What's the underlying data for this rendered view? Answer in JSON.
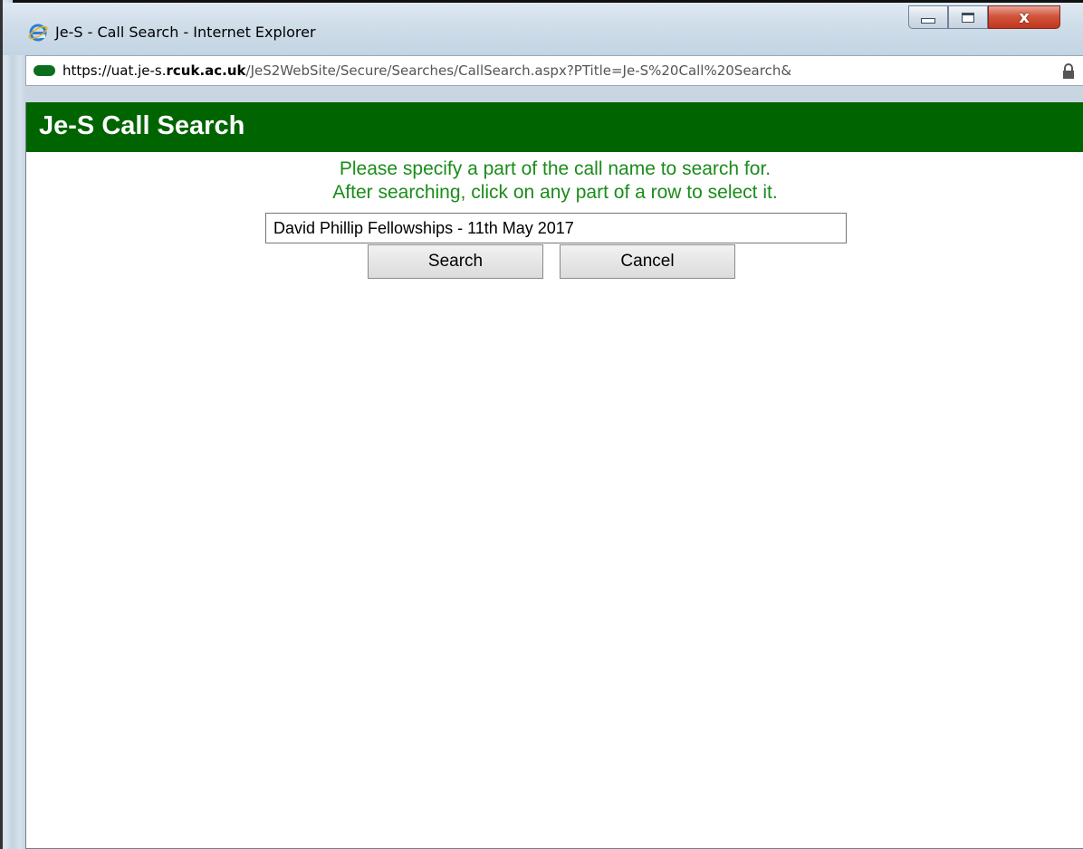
{
  "window": {
    "title": "Je-S - Call Search - Internet Explorer",
    "controls": {
      "minimize": "minimize-icon",
      "maximize": "maximize-icon",
      "close": "close-icon"
    }
  },
  "address_bar": {
    "url_prefix": "https://uat.je-s.",
    "url_domain": "rcuk.ac.uk",
    "url_path": "/JeS2WebSite/Secure/Searches/CallSearch.aspx?PTitle=Je-S%20Call%20Search&",
    "site_icon": "site-identity-icon",
    "lock_icon": "lock-icon"
  },
  "page": {
    "header_title": "Je-S Call Search",
    "instruction_line1": "Please specify a part of the call name to search for.",
    "instruction_line2": "After searching, click on any part of a row to select it.",
    "search_value": "David Phillip Fellowships - 11th May 2017",
    "search_button": "Search",
    "cancel_button": "Cancel"
  },
  "colors": {
    "header_bg": "#006400",
    "instruction_text": "#1a8c1a",
    "close_button": "#c0351d"
  }
}
